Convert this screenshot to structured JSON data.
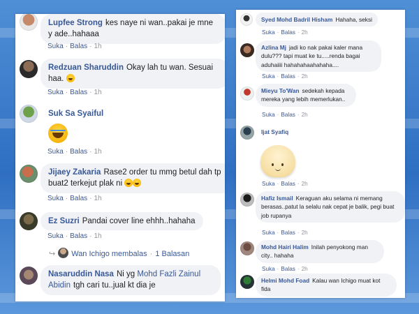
{
  "common": {
    "like_label": "Suka",
    "reply_label": "Balas",
    "separator": "·"
  },
  "left_comments": [
    {
      "name": "Lupfee Strong",
      "text": "kes naye ni wan..pakai je mne y ade..hahaaa",
      "time": "1h"
    },
    {
      "name": "Redzuan Sharuddin",
      "text": "Okay lah tu wan. Sesuai haa.",
      "time": "1h",
      "emoji": "laughing-emoji"
    },
    {
      "name": "Suk Sa Syaiful",
      "text": "",
      "time": "1h",
      "emoji": "laughing-tears-emoji"
    },
    {
      "name": "Jijaey Zakaria",
      "text": "Rase2 order tu mmg betul dah tp buat2 terkejut plak ni",
      "time": "1h",
      "emoji": "laughing-emoji"
    },
    {
      "name": "Ez Suzri",
      "text": "Pandai cover line ehhh..hahaha",
      "time": "1h"
    },
    {
      "name": "Nasaruddin Nasa",
      "text": "Ni yg",
      "mention": "Mohd Fazli Zainul Abidin",
      "text_after": "tgh cari tu..jual kt dia je"
    }
  ],
  "reply_summary": {
    "replier": "Wan Ichigo membalas",
    "count": "1 Balasan"
  },
  "right_comments": [
    {
      "name": "Syed Mohd Badril Hisham",
      "text": "Hahaha, seksi",
      "time": "2h"
    },
    {
      "name": "Azlina Mj",
      "text": "jadi ko nak pakai kaler mana dulu??? tapi muat ke tu.....renda bagai aduhaiiii hahahahaahahaha....",
      "time": "2h"
    },
    {
      "name": "Mieyu To'Wan",
      "text": "sedekah kepada mereka yang lebih memerlukan..",
      "time": "2h"
    },
    {
      "name": "Ijat Syafiq",
      "text": "",
      "time": "2h",
      "sticker": "smiling-bun-sticker"
    },
    {
      "name": "Hafiz Ismail",
      "text": "Keraguan aku selama ni memang berasas..patut la selalu nak cepat je balik, pegi buat job rupanya",
      "time": "2h"
    },
    {
      "name": "Mohd Hairi Halim",
      "text": "Inilah penyokong man city.. hahaha",
      "time": "2h"
    },
    {
      "name": "Helmi Mohd Foad",
      "text": "Kalau wan Ichigo muat kot fida"
    }
  ],
  "colors": {
    "name_link": "#385898",
    "bubble_bg": "#f0f2f5",
    "muted": "#90949c",
    "background": "#2f6fc2"
  }
}
